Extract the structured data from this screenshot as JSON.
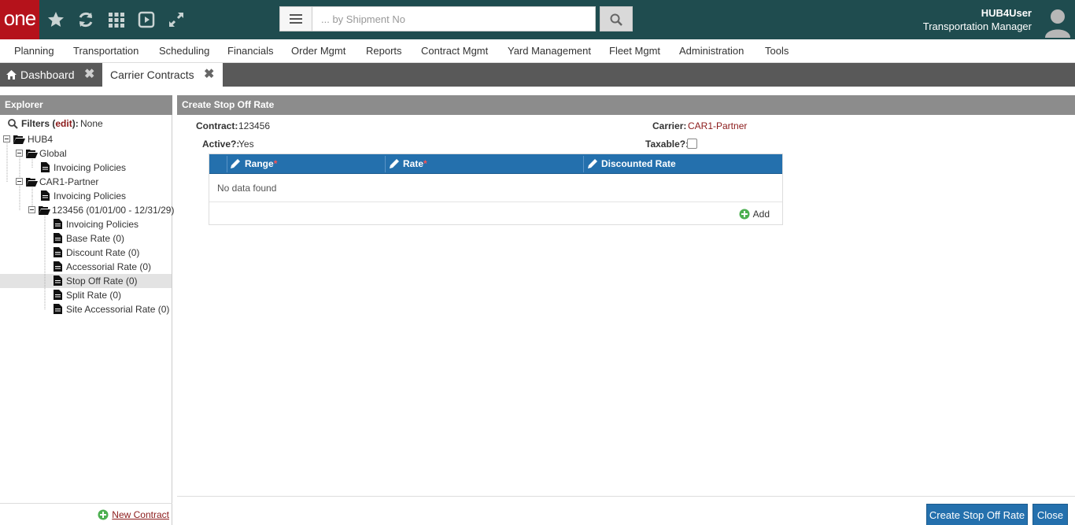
{
  "header": {
    "logo_text": "one",
    "search_placeholder": "... by Shipment No",
    "user_name": "HUB4User",
    "user_role": "Transportation Manager",
    "icons": [
      "star-icon",
      "refresh-icon",
      "apps-grid-icon",
      "play-icon",
      "expand-icon",
      "menu-icon",
      "search-icon",
      "avatar-icon"
    ]
  },
  "menu": {
    "items": [
      "Planning",
      "Transportation",
      "Scheduling",
      "Financials",
      "Order Mgmt",
      "Reports",
      "Contract Mgmt",
      "Yard Management",
      "Fleet Mgmt",
      "Administration",
      "Tools"
    ]
  },
  "tabs": [
    {
      "label": "Dashboard",
      "active": false
    },
    {
      "label": "Carrier Contracts",
      "active": true
    }
  ],
  "explorer": {
    "title": "Explorer",
    "filters_label": "Filters",
    "filters_edit": "edit",
    "filters_value": "None",
    "tree": [
      {
        "label": "HUB4"
      },
      {
        "label": "Global"
      },
      {
        "label": "Invoicing Policies"
      },
      {
        "label": "CAR1-Partner"
      },
      {
        "label": "Invoicing Policies"
      },
      {
        "label": "123456 (01/01/00 - 12/31/29)"
      },
      {
        "label": "Invoicing Policies"
      },
      {
        "label": "Base Rate (0)"
      },
      {
        "label": "Discount Rate (0)"
      },
      {
        "label": "Accessorial Rate (0)"
      },
      {
        "label": "Stop Off Rate (0)"
      },
      {
        "label": "Split Rate (0)"
      },
      {
        "label": "Site Accessorial Rate (0)"
      }
    ],
    "new_contract": "New Contract"
  },
  "form": {
    "title": "Create Stop Off Rate",
    "contract_label": "Contract:",
    "contract_value": "123456",
    "carrier_label": "Carrier:",
    "carrier_value": "CAR1-Partner",
    "active_label": "Active?:",
    "active_value": "Yes",
    "taxable_label": "Taxable?:",
    "taxable_checked": false
  },
  "grid": {
    "columns": [
      {
        "label": "Range",
        "required": true
      },
      {
        "label": "Rate",
        "required": true
      },
      {
        "label": "Discounted Rate",
        "required": false
      }
    ],
    "required_marker": "*",
    "empty_text": "No data found",
    "add_label": "Add"
  },
  "actions": {
    "create_label": "Create Stop Off Rate",
    "close_label": "Close"
  },
  "colors": {
    "header_bg": "#1f4c4f",
    "logo_bg": "#b5121b",
    "grid_header_bg": "#2470ad",
    "button_bg": "#2470ad",
    "link_red": "#8b1a1a"
  }
}
